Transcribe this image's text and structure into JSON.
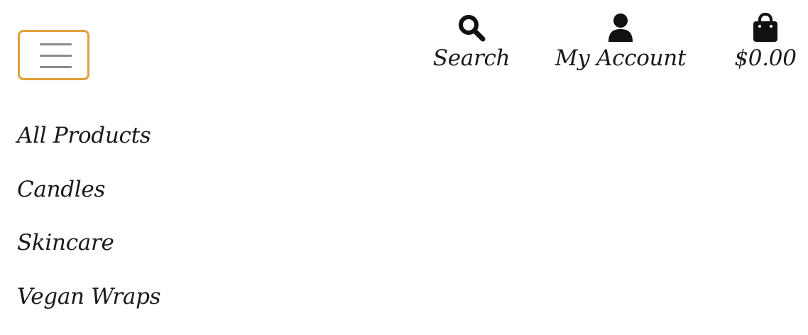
{
  "header": {
    "menu_button": {
      "icon": "hamburger-menu-icon",
      "border_color": "#e0a03a"
    },
    "actions": {
      "search": {
        "label": "Search",
        "icon": "search-icon"
      },
      "account": {
        "label": "My Account",
        "icon": "user-icon"
      },
      "cart": {
        "label": "$0.00",
        "icon": "shopping-bag-icon"
      }
    }
  },
  "nav": {
    "items": [
      {
        "label": "All Products"
      },
      {
        "label": "Candles"
      },
      {
        "label": "Skincare"
      },
      {
        "label": "Vegan Wraps"
      }
    ]
  },
  "colors": {
    "accent": "#e0a03a",
    "text": "#1a1a1a",
    "icon": "#111111",
    "menu_bars": "#8a8a8a"
  }
}
